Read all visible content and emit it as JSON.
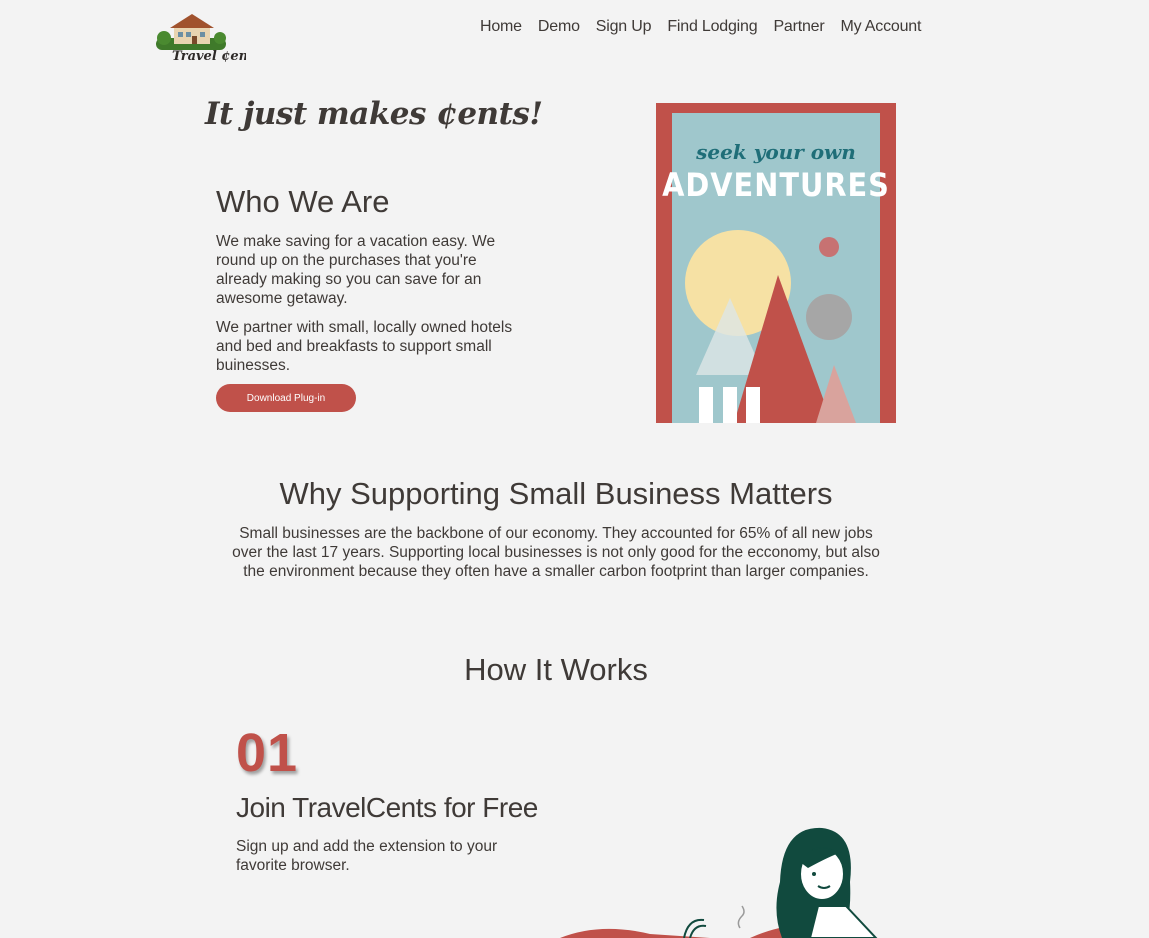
{
  "header": {
    "logo_text": "Travel ¢ents",
    "nav": [
      "Home",
      "Demo",
      "Sign Up",
      "Find Lodging",
      "Partner",
      "My Account"
    ]
  },
  "hero": {
    "tagline": "It just makes ¢ents!",
    "who_title": "Who We Are",
    "who_p1": "We make saving for a vacation easy. We round up on the purchases that you're already making so you can save for an awesome getaway.",
    "who_p2": "We partner with small, locally owned hotels and bed and breakfasts to support small buinesses.",
    "download_label": "Download Plug-in",
    "poster_line1": "seek your own",
    "poster_line2": "ADVENTURES"
  },
  "why": {
    "title": "Why Supporting Small Business Matters",
    "body": "Small businesses are the backbone of our economy. They accounted for 65% of all new jobs over the last 17 years. Supporting local businesses is not only good for the ecconomy, but also the environment because they often have a smaller carbon footprint than larger companies."
  },
  "how": {
    "title": "How It Works",
    "step_number": "01",
    "step_title": "Join TravelCents for Free",
    "step_body": "Sign up and add the extension to your favorite browser."
  },
  "colors": {
    "accent": "#c0514a",
    "text": "#3f3a37",
    "background": "#f3f3f3",
    "poster_sky": "#9fc7cc"
  }
}
